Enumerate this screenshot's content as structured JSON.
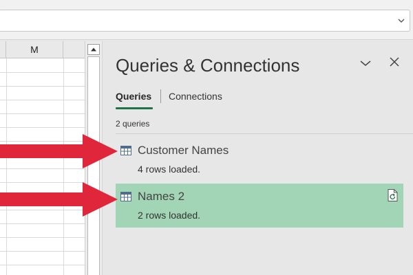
{
  "grid": {
    "column_header": "M"
  },
  "pane": {
    "title": "Queries & Connections",
    "tabs": [
      {
        "label": "Queries",
        "active": true
      },
      {
        "label": "Connections",
        "active": false
      }
    ],
    "query_count": "2 queries",
    "queries": [
      {
        "name": "Customer Names",
        "status": "4 rows loaded.",
        "selected": false,
        "icon": "table-icon"
      },
      {
        "name": "Names 2",
        "status": "2 rows loaded.",
        "selected": true,
        "icon": "table-icon"
      }
    ]
  },
  "annotations": {
    "arrow_color": "#e0263b",
    "arrows": [
      "arrow-to-customer-names",
      "arrow-to-names-2"
    ]
  },
  "colors": {
    "accent_green": "#217346",
    "selected_row": "#a2d5b5",
    "pane_background": "#e7e7e7"
  },
  "icons": [
    "chevron-down-icon",
    "close-icon",
    "table-icon",
    "refresh-query-icon",
    "scroll-up-arrow-icon",
    "dropdown-icon"
  ]
}
